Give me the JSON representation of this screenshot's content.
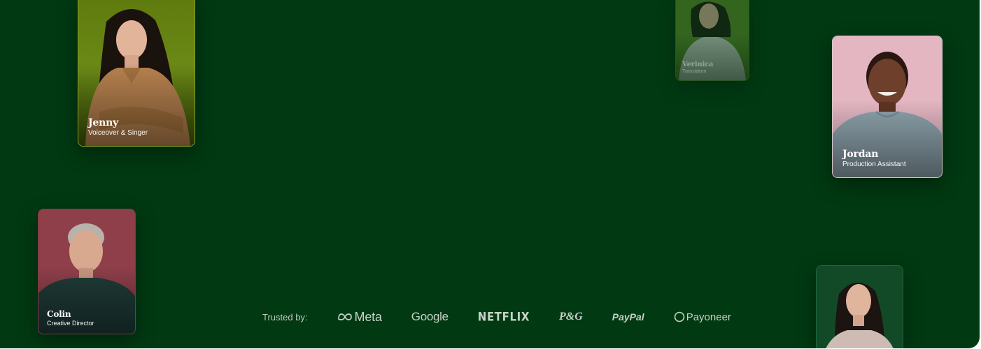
{
  "cards": [
    {
      "id": "jenny",
      "name": "Jenny",
      "role": "Voiceover & Singer"
    },
    {
      "id": "verinica",
      "name": "Verinica",
      "role": "Translation"
    },
    {
      "id": "jordan",
      "name": "Jordan",
      "role": "Production Assistant"
    },
    {
      "id": "colin",
      "name": "Colin",
      "role": "Creative Director"
    }
  ],
  "trusted": {
    "label": "Trusted by:",
    "logos": {
      "meta": "Meta",
      "google": "Google",
      "netflix": "NETFLIX",
      "pg": "P&G",
      "paypal": "PayPal",
      "payoneer": "Payoneer"
    }
  },
  "colors": {
    "background": "#003912",
    "text_muted": "#c7d1c9"
  },
  "icons": [
    "meta-infinity-icon",
    "payoneer-circle-icon"
  ]
}
